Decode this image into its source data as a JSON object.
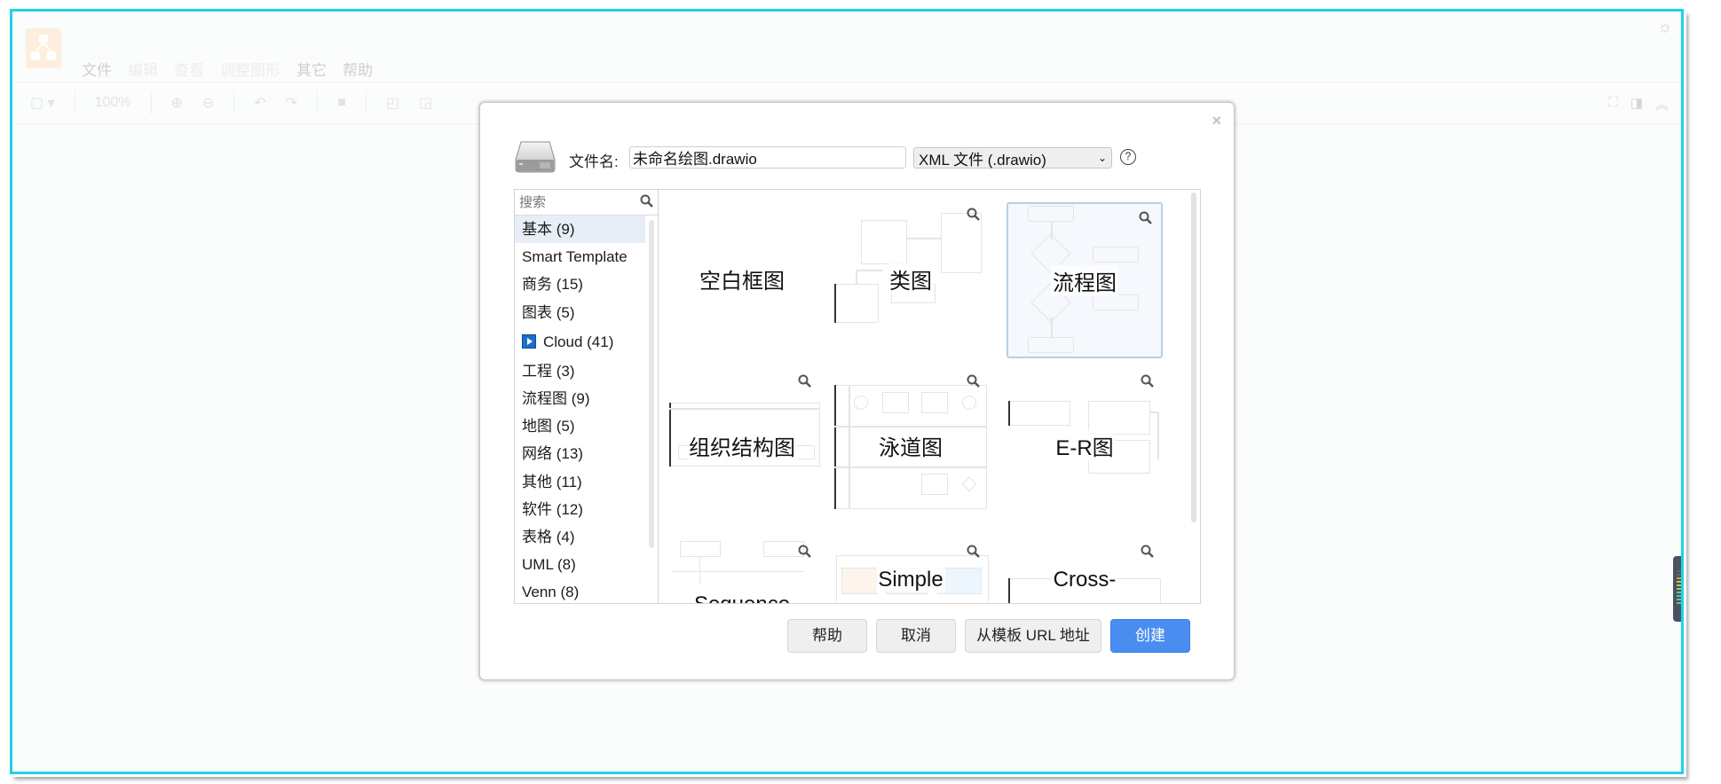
{
  "app": {
    "menu": [
      {
        "label": "文件",
        "enabled": true
      },
      {
        "label": "编辑",
        "enabled": false
      },
      {
        "label": "查看",
        "enabled": false
      },
      {
        "label": "调整图形",
        "enabled": false
      },
      {
        "label": "其它",
        "enabled": true
      },
      {
        "label": "帮助",
        "enabled": true
      }
    ],
    "toolbar": {
      "zoom": "100%"
    }
  },
  "dialog": {
    "filename_label": "文件名:",
    "filename_value": "未命名绘图.drawio",
    "format_selected": "XML 文件 (.drawio)",
    "help_glyph": "?",
    "close_glyph": "×",
    "search_placeholder": "搜索",
    "categories": [
      {
        "label": "基本 (9)",
        "selected": true
      },
      {
        "label": "Smart Template"
      },
      {
        "label": "商务 (15)"
      },
      {
        "label": "图表 (5)"
      },
      {
        "label": "Cloud (41)",
        "badge": "cloud-icon"
      },
      {
        "label": "工程 (3)"
      },
      {
        "label": "流程图 (9)"
      },
      {
        "label": "地图 (5)"
      },
      {
        "label": "网络 (13)"
      },
      {
        "label": "其他 (11)"
      },
      {
        "label": "软件 (12)"
      },
      {
        "label": "表格 (4)"
      },
      {
        "label": "UML (8)"
      },
      {
        "label": "Venn (8)"
      }
    ],
    "templates": [
      {
        "name": "空白框图"
      },
      {
        "name": "类图"
      },
      {
        "name": "流程图",
        "selected": true
      },
      {
        "name": "组织结构图"
      },
      {
        "name": "泳道图"
      },
      {
        "name": "E-R图"
      },
      {
        "name": "Sequence"
      },
      {
        "name": "Simple"
      },
      {
        "name": "Cross-"
      }
    ],
    "buttons": {
      "help": "帮助",
      "cancel": "取消",
      "from_url": "从模板 URL 地址",
      "create": "创建"
    }
  }
}
